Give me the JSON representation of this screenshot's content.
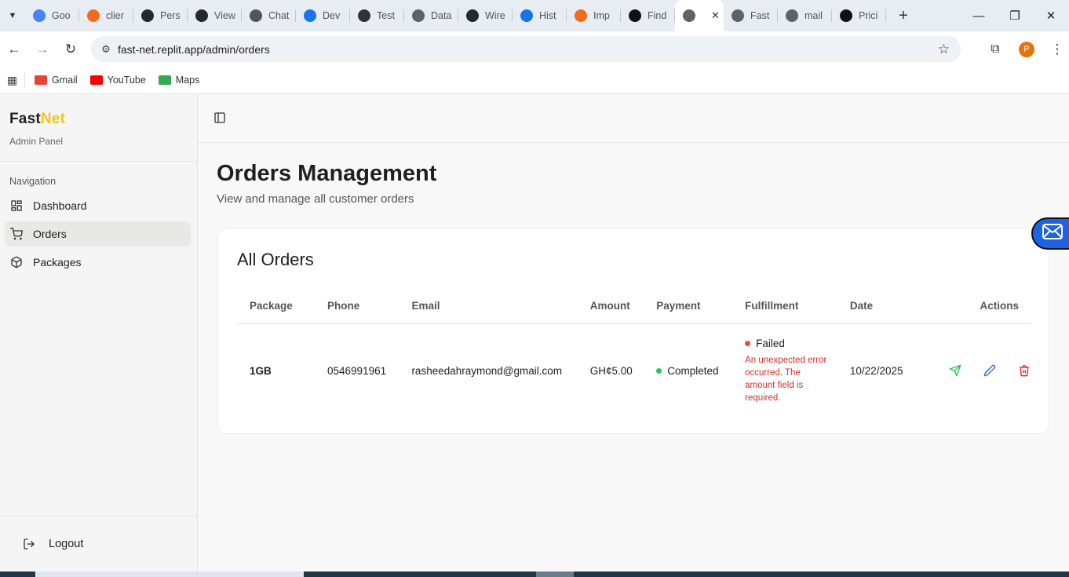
{
  "browser": {
    "tabs": [
      {
        "label": "Goo",
        "color": "#4285f4"
      },
      {
        "label": "clier",
        "color": "#f26a1b"
      },
      {
        "label": "Pers",
        "color": "#24292f"
      },
      {
        "label": "View",
        "color": "#24292f"
      },
      {
        "label": "Chat",
        "color": "#555555"
      },
      {
        "label": "Dev",
        "color": "#1a73e8"
      },
      {
        "label": "Test",
        "color": "#333333"
      },
      {
        "label": "Data",
        "color": "#5f6368"
      },
      {
        "label": "Wire",
        "color": "#24292f"
      },
      {
        "label": "Hist",
        "color": "#1a73e8"
      },
      {
        "label": "Imp",
        "color": "#f26a1b"
      },
      {
        "label": "Find",
        "color": "#111111"
      },
      {
        "label": "",
        "color": "#5f6368",
        "active": true
      },
      {
        "label": "Fast",
        "color": "#5f6368"
      },
      {
        "label": "mail",
        "color": "#5f6368"
      },
      {
        "label": "Prici",
        "color": "#111111"
      }
    ],
    "url": "fast-net.replit.app/admin/orders",
    "profile_initial": "P",
    "bookmarks": [
      {
        "label": "Gmail",
        "color": "#ea4335"
      },
      {
        "label": "YouTube",
        "color": "#ff0000"
      },
      {
        "label": "Maps",
        "color": "#34a853"
      }
    ]
  },
  "sidebar": {
    "brand_part1": "Fast",
    "brand_part2": "Net",
    "subtitle": "Admin Panel",
    "nav_heading": "Navigation",
    "items": [
      {
        "label": "Dashboard",
        "icon": "dashboard-icon"
      },
      {
        "label": "Orders",
        "icon": "cart-icon",
        "active": true
      },
      {
        "label": "Packages",
        "icon": "package-icon"
      }
    ],
    "logout_label": "Logout"
  },
  "main": {
    "title": "Orders Management",
    "subtitle": "View and manage all customer orders",
    "card_title": "All Orders",
    "columns": [
      "Package",
      "Phone",
      "Email",
      "Amount",
      "Payment",
      "Fulfillment",
      "Date",
      "Actions"
    ],
    "rows": [
      {
        "package": "1GB",
        "phone": "0546991961",
        "email": "rasheedahraymond@gmail.com",
        "amount": "GH¢5.00",
        "payment": "Completed",
        "payment_color": "#22c55e",
        "fulfillment": "Failed",
        "fulfillment_color": "#ef4444",
        "fulfillment_error": "An unexpected error occurred. The amount field is required.",
        "date": "10/22/2025"
      }
    ]
  },
  "colors": {
    "accent_yellow": "#f5c518",
    "send_green": "#22c55e",
    "edit_blue": "#2563eb",
    "delete_red": "#dc2626"
  }
}
